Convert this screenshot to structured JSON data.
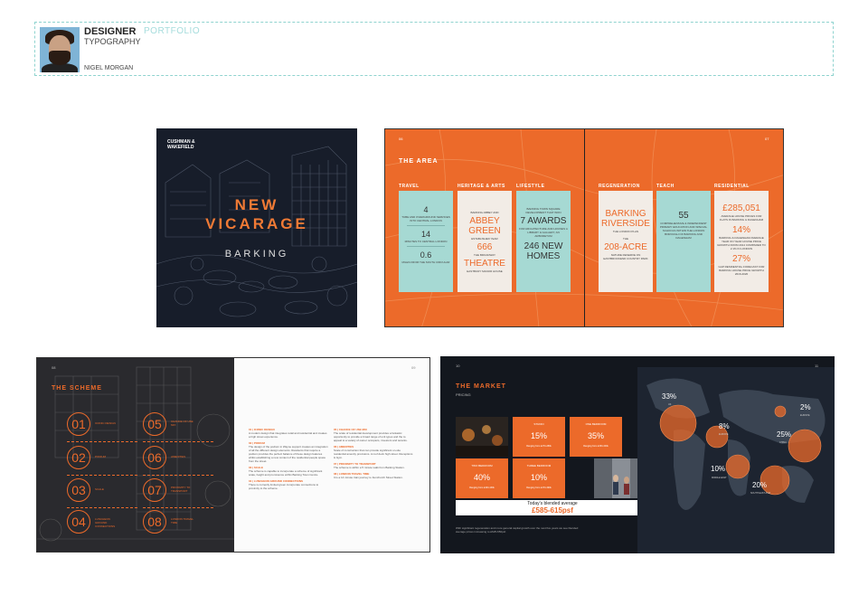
{
  "header": {
    "title": "DESIGNER",
    "subtitle": "TYPOGRAPHY",
    "portfolio": "PORTFOLIO",
    "name": "NIGEL MORGAN"
  },
  "cover": {
    "logo_line1": "CUSHMAN &",
    "logo_line2": "WAKEFIELD",
    "title_line1": "NEW",
    "title_line2": "VICARAGE",
    "subtitle": "BARKING"
  },
  "area": {
    "page_left": "06",
    "page_right": "07",
    "title": "THE AREA",
    "categories": {
      "travel": "TRAVEL",
      "heritage": "HERITAGE & ARTS",
      "lifestyle": "LIFESTYLE",
      "regeneration": "REGENERATION",
      "teach": "TEACH",
      "residential": "RESIDENTIAL"
    },
    "travel": {
      "v1": "4",
      "l1": "TUBE AND OVERGROUND SERVICES INTO CENTRAL LONDON",
      "v2": "14",
      "l2": "MINUTES TO CENTRAL LONDON",
      "v3": "0.6",
      "l3": "MILES FROM THE SOUTH CIRCULAR"
    },
    "heritage": {
      "pre": "BARKING ABBEY AND",
      "name": "ABBEY GREEN",
      "est": "ESTABLISHED YEAR",
      "year": "666",
      "the": "THE BROADWAY",
      "theatre": "THEATRE",
      "foot": "EASTBURY MANOR HOUSE"
    },
    "lifestyle": {
      "pre": "BARKING TOWN SQUARE DEVELOPMENT THAT WON",
      "awards": "7 AWARDS",
      "mid": "FOR ARCHITECTURE AND HOUSES A LIBRARY & GALLERY, AN ARBORETUM",
      "homes": "246 NEW HOMES"
    },
    "regeneration": {
      "name": "BARKING RIVERSIDE",
      "sub": "THE LONDON PLAN",
      "the": "THE",
      "acre": "208-ACRE",
      "foot": "NATURE RESERVE ON EASTBROOKEND COUNTRY PARK"
    },
    "teach": {
      "value": "55",
      "label": "COMPREHENSIVE & INDEPENDENT PRIMARY EDUCATION AND SPECIAL SCHOOLS WITHIN THE LONDON BOROUGH OF BARKING AND DAGENHAM"
    },
    "residential": {
      "v1": "£285,051",
      "l1": "AVERAGE HOUSE PRICES FOR FLATS IN BARKING & DAGENHAM",
      "v2": "14%",
      "l2": "BARKING & DAGENHAM AVERAGE YEAR ON YEAR HOUSE PRICE GROWTH FROM 2014 COMPARED TO 2.1% IN LONDON",
      "v3": "27%",
      "l3": "GAP RESIDENTIAL FORECAST FOR BARKING HOUSE PRICE GROWTH 2016-2020"
    }
  },
  "scheme": {
    "page_left": "08",
    "page_right": "09",
    "title": "THE SCHEME",
    "items": [
      {
        "num": "01",
        "label": "ICONIC DESIGN"
      },
      {
        "num": "05",
        "label": "CHANCE OF USE MIX"
      },
      {
        "num": "02",
        "label": "PODIUM"
      },
      {
        "num": "06",
        "label": "AMENITIES"
      },
      {
        "num": "03",
        "label": "SCALE"
      },
      {
        "num": "07",
        "label": "PROXIMITY TO TRANSPORT"
      },
      {
        "num": "04",
        "label": "LUNCHEON GROUND CONNECTIONS"
      },
      {
        "num": "08",
        "label": "LONDON TRAVEL TIME"
      }
    ],
    "col1": [
      {
        "hd": "01 | ICONIC DESIGN",
        "tx": "A modern design that integrates retail and residential and creates a high street experience."
      },
      {
        "hd": "02 | PODIUM",
        "tx": "The design of the podium in Wayne support creates an integration of all the different design elements. Residents that require a podium provides the perfect balance of these design features whilst establishing a new context of the residential people space from the street."
      },
      {
        "hd": "03 | SCALE",
        "tx": "The scheme is capable to incorporate a scheme of significant scale, height and prominence within Barking Town Centre."
      },
      {
        "hd": "04 | LUNCHEON GROUND CONNECTIONS",
        "tx": "There is currently limited green incorporate connections to proximity to the scheme."
      }
    ],
    "col2": [
      {
        "hd": "05 | CHANCE OF USE MIX",
        "tx": "The scale of residential development provides a fantastic opportunity to provide a broad range of unit types and the to appeal to a variety of owner occupiers, investors and tenants."
      },
      {
        "hd": "06 | AMENITIES",
        "tx": "Scale of construction that can provide significant on-site residential amenity provisions. A roof deck high street. Receptions & Gym."
      },
      {
        "hd": "07 | PROXIMITY TO TRANSPORT",
        "tx": "The scheme is within a 5 minute walk from Barking Station."
      },
      {
        "hd": "08 | LONDON TRAVEL TIME",
        "tx": "It is a 14 minute train journey to Fenchurch Street Station."
      }
    ]
  },
  "market": {
    "page_left": "10",
    "page_right": "11",
    "title": "THE MARKET",
    "subtitle": "PRICING",
    "boxes": [
      {
        "label": "STUDIO",
        "value": "15%",
        "sub": "Ranging from £270-280k"
      },
      {
        "label": "ONE BEDROOM",
        "value": "35%",
        "sub": "Ranging from £330-340k"
      },
      {
        "label": "TWO BEDROOM",
        "value": "40%",
        "sub": "Ranging from £400-430k"
      },
      {
        "label": "THREE BEDROOM",
        "value": "10%",
        "sub": "Ranging from £470-490k"
      }
    ],
    "blend_label": "Today's blended average",
    "blend_value": "£585-615psf",
    "footer": "With significant regeneration and more general capital growth over the next five years we see blended average prices increasing to £625-650psf.",
    "regions": [
      {
        "value": "33%",
        "name": "UK"
      },
      {
        "value": "2%",
        "name": "EUROPE"
      },
      {
        "value": "8%",
        "name": "EUROPE"
      },
      {
        "value": "25%",
        "name": "CHINA"
      },
      {
        "value": "10%",
        "name": "MIDDLE EAST"
      },
      {
        "value": "20%",
        "name": "SOUTH EAST ASIA"
      }
    ]
  },
  "colors": {
    "accent": "#ec6a2a",
    "teal": "#a6d9d3",
    "navy": "#171d2a"
  }
}
